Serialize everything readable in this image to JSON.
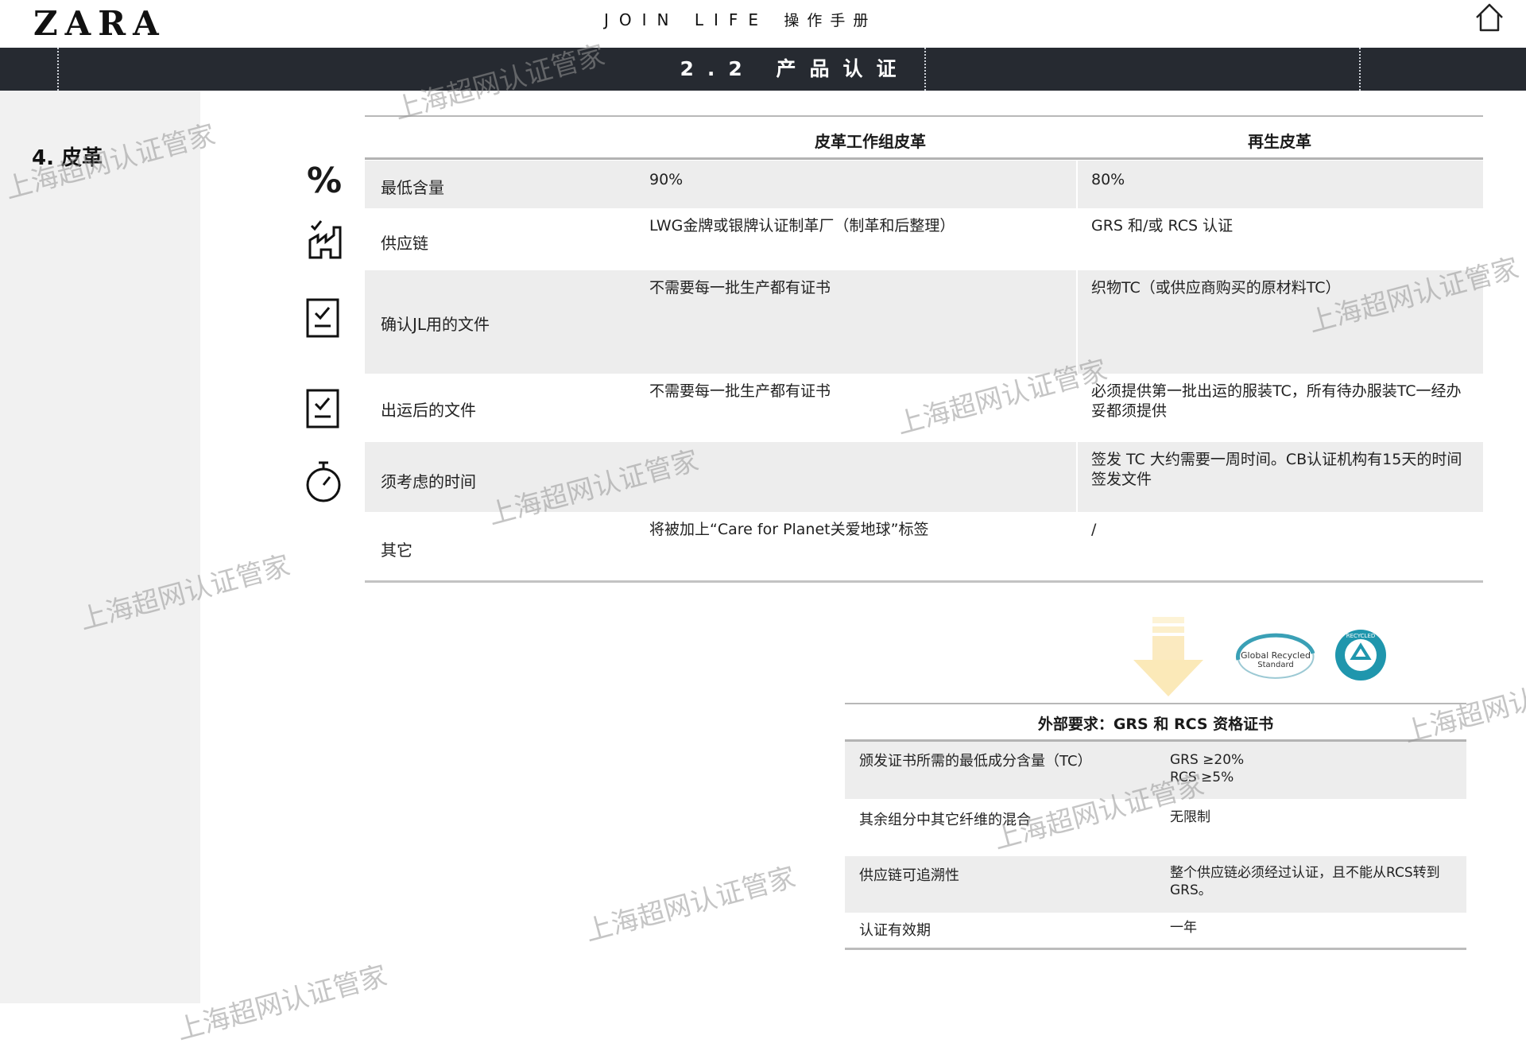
{
  "header": {
    "logo": "ZARA",
    "brand_en": "JOIN LIFE",
    "brand_cn": "操作手册",
    "home_icon": "home-icon"
  },
  "banner": {
    "title": "2.2 产品认证"
  },
  "section": {
    "label": "4. 皮革"
  },
  "main_table": {
    "columns": [
      "皮革工作组皮革",
      "再生皮革"
    ],
    "rows": [
      {
        "icon": "percent-icon",
        "label": "最低含量",
        "a": "90%",
        "b": "80%"
      },
      {
        "icon": "factory-icon",
        "label": "供应链",
        "a": "LWG金牌或银牌认证制革厂（制革和后整理）",
        "b": "GRS 和/或 RCS 认证"
      },
      {
        "icon": "checklist-icon",
        "label": "确认JL用的文件",
        "a": "不需要每一批生产都有证书",
        "b": "织物TC（或供应商购买的原材料TC）"
      },
      {
        "icon": "checklist-icon",
        "label": "出运后的文件",
        "a": "不需要每一批生产都有证书",
        "b": "必须提供第一批出运的服装TC，所有待办服装TC一经办妥都须提供"
      },
      {
        "icon": "stopwatch-icon",
        "label": "须考虑的时间",
        "a": "",
        "b": "签发 TC 大约需要一周时间。CB认证机构有15天的时间签发文件"
      },
      {
        "icon": "",
        "label": "其它",
        "a": "将被加上“Care for Planet关爱地球”标签",
        "b": "/"
      }
    ]
  },
  "logos": {
    "grs_text_1": "Global Recycled",
    "grs_text_2": "Standard",
    "rcs_text": "RECYCLED"
  },
  "sub_table": {
    "title": "外部要求：GRS 和 RCS 资格证书",
    "rows": [
      {
        "label": "颁发证书所需的最低成分含量（TC）",
        "value": "GRS ≥20%",
        "value2": "RCS ≥5%"
      },
      {
        "label": "其余组分中其它纤维的混合",
        "value": "无限制"
      },
      {
        "label": "供应链可追溯性",
        "value": "整个供应链必须经过认证，且不能从RCS转到 GRS。"
      },
      {
        "label": "认证有效期",
        "value": "一年"
      }
    ]
  },
  "watermark": {
    "text": "上海超网认证管家"
  }
}
